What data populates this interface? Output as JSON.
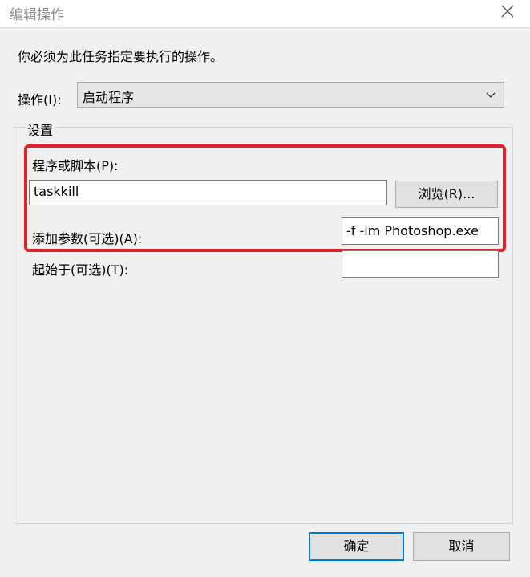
{
  "window": {
    "title": "编辑操作",
    "close_glyph": "close-icon"
  },
  "instruction": "你必须为此任务指定要执行的操作。",
  "operation": {
    "label": "操作(I):",
    "selected": "启动程序"
  },
  "settings": {
    "group_label": "设置",
    "program_label": "程序或脚本(P):",
    "program_value": "taskkill",
    "browse_label": "浏览(R)...",
    "args_label": "添加参数(可选)(A):",
    "args_value": "-f -im Photoshop.exe",
    "startin_label": "起始于(可选)(T):",
    "startin_value": ""
  },
  "footer": {
    "ok_label": "确定",
    "cancel_label": "取消"
  },
  "colors": {
    "highlight": "#e0202a",
    "default_button_border": "#0078d7"
  }
}
